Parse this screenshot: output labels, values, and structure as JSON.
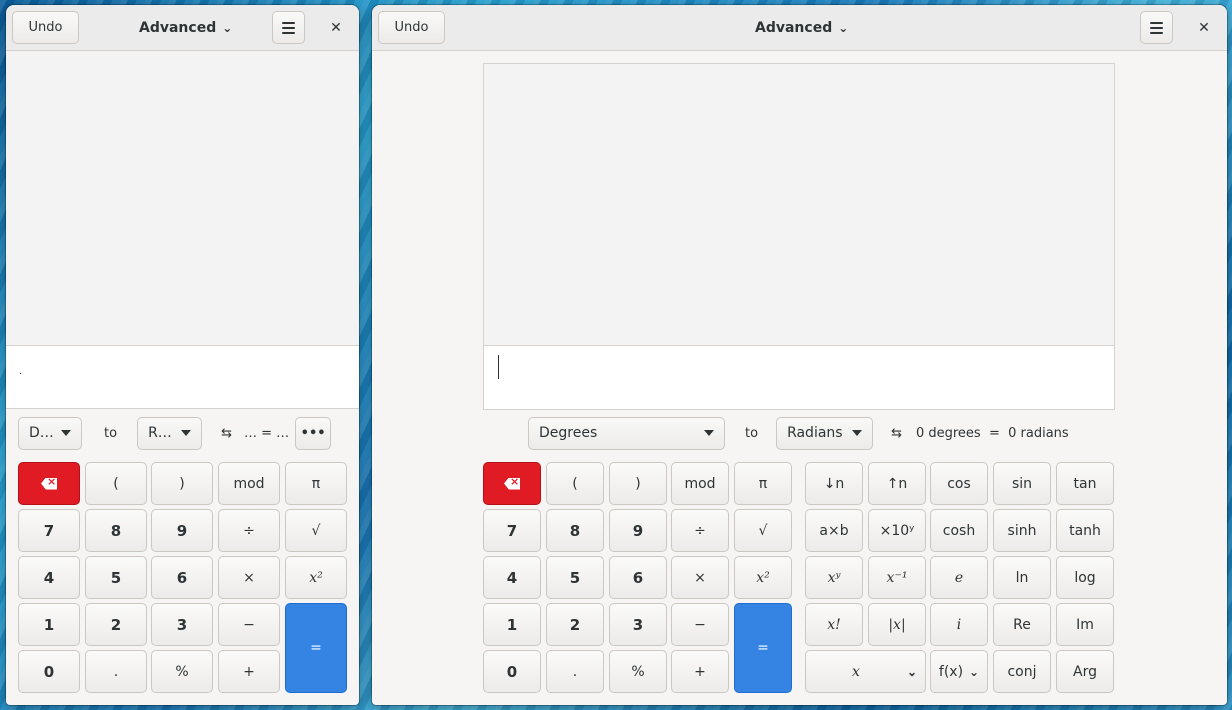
{
  "left_window": {
    "header": {
      "undo_label": "Undo",
      "mode_label": "Advanced",
      "menu_icon": "hamburger-menu-icon",
      "close_icon": "close-icon"
    },
    "entry_text": ".",
    "converter": {
      "from_unit": "D…",
      "to_label": "to",
      "to_unit": "R…",
      "swap_icon": "swap-arrows-icon",
      "result": "… = …",
      "more_icon": "more-dots-icon"
    },
    "keypad": {
      "backspace_icon": "backspace-icon",
      "rows": [
        [
          "(",
          ")",
          "mod",
          "π"
        ],
        [
          "7",
          "8",
          "9",
          "÷",
          "√"
        ],
        [
          "4",
          "5",
          "6",
          "×",
          "x²"
        ],
        [
          "1",
          "2",
          "3",
          "−"
        ],
        [
          "0",
          ".",
          "%",
          "+"
        ]
      ],
      "equals": "="
    }
  },
  "right_window": {
    "header": {
      "undo_label": "Undo",
      "mode_label": "Advanced",
      "menu_icon": "hamburger-menu-icon",
      "close_icon": "close-icon"
    },
    "entry_text": "",
    "converter": {
      "from_unit": "Degrees",
      "to_label": "to",
      "to_unit": "Radians",
      "swap_icon": "swap-arrows-icon",
      "result": "0 degrees  =  0 radians"
    },
    "keypad": {
      "backspace_icon": "backspace-icon",
      "rows": [
        [
          "(",
          ")",
          "mod",
          "π"
        ],
        [
          "7",
          "8",
          "9",
          "÷",
          "√"
        ],
        [
          "4",
          "5",
          "6",
          "×",
          "x²"
        ],
        [
          "1",
          "2",
          "3",
          "−"
        ],
        [
          "0",
          ".",
          "%",
          "+"
        ]
      ],
      "equals": "="
    },
    "function_keys": {
      "row1": [
        "↓n",
        "↑n",
        "cos",
        "sin",
        "tan"
      ],
      "row2": [
        "a×b",
        "×10ʸ",
        "cosh",
        "sinh",
        "tanh"
      ],
      "row3": [
        "xʸ",
        "x⁻¹",
        "e",
        "ln",
        "log"
      ],
      "row4": [
        "x!",
        "|x|",
        "i",
        "Re",
        "Im"
      ],
      "row5": [
        "x",
        "f(x)",
        "conj",
        "Arg"
      ]
    }
  },
  "colors": {
    "accent_blue": "#3584e4",
    "destructive_red": "#e01b24",
    "window_bg": "#f6f5f4"
  }
}
